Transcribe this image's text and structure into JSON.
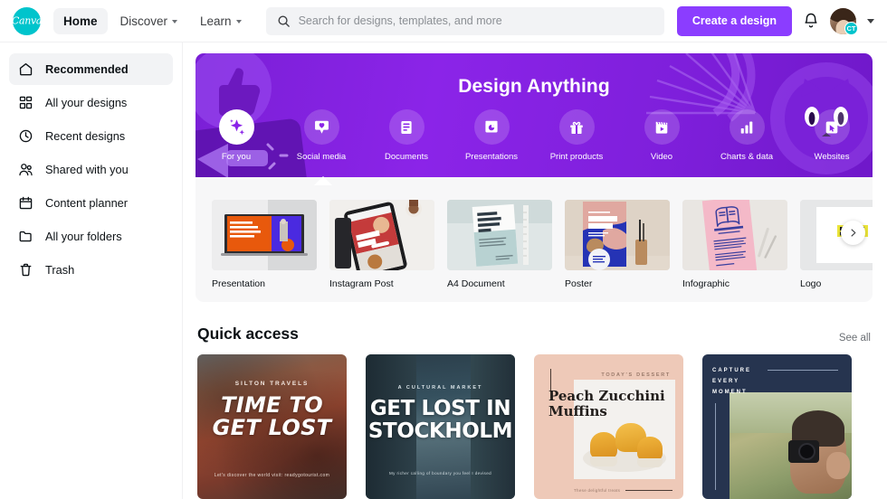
{
  "brand": {
    "name": "Canva",
    "logo_color": "#00c4cc",
    "accent_color": "#8b3dff"
  },
  "header": {
    "nav": [
      {
        "label": "Home",
        "active": true,
        "has_caret": false
      },
      {
        "label": "Discover",
        "active": false,
        "has_caret": true
      },
      {
        "label": "Learn",
        "active": false,
        "has_caret": true
      }
    ],
    "search": {
      "placeholder": "Search for designs, templates, and more",
      "value": "",
      "icon": "search-icon"
    },
    "create_button": "Create a design",
    "notifications_icon": "bell-icon",
    "avatar_badge": "CT",
    "account_caret_icon": "chevron-down-icon"
  },
  "sidebar": {
    "items": [
      {
        "label": "Recommended",
        "icon": "home-icon",
        "active": true
      },
      {
        "label": "All your designs",
        "icon": "grid-icon",
        "active": false
      },
      {
        "label": "Recent designs",
        "icon": "clock-icon",
        "active": false
      },
      {
        "label": "Shared with you",
        "icon": "people-icon",
        "active": false
      },
      {
        "label": "Content planner",
        "icon": "calendar-icon",
        "active": false
      },
      {
        "label": "All your folders",
        "icon": "folder-icon",
        "active": false
      },
      {
        "label": "Trash",
        "icon": "trash-icon",
        "active": false
      }
    ]
  },
  "banner": {
    "title": "Design Anything",
    "background_color": "#8b24e8",
    "categories": [
      {
        "label": "For you",
        "icon": "sparkle-icon",
        "featured": true
      },
      {
        "label": "Social media",
        "icon": "heart-chat-icon",
        "featured": false
      },
      {
        "label": "Documents",
        "icon": "document-icon",
        "featured": false
      },
      {
        "label": "Presentations",
        "icon": "presentation-icon",
        "featured": false
      },
      {
        "label": "Print products",
        "icon": "gift-icon",
        "featured": false
      },
      {
        "label": "Video",
        "icon": "clapperboard-icon",
        "featured": false
      },
      {
        "label": "Charts & data",
        "icon": "bar-chart-icon",
        "featured": false
      },
      {
        "label": "Websites",
        "icon": "website-icon",
        "featured": false
      }
    ],
    "decorations": [
      "thumbs-up-icon",
      "megaphone-icon",
      "cat-face-icon",
      "sunburst-icon"
    ]
  },
  "templates": {
    "next_arrow_icon": "chevron-right-icon",
    "items": [
      {
        "label": "Presentation",
        "preview_text": "WHY CHOOSE THE ACTIVE LIFESTYLE"
      },
      {
        "label": "Instagram Post",
        "preview_text": "MID YEAR SALE"
      },
      {
        "label": "A4 Document",
        "preview_text": "MID-QUARTER REPORT 2021"
      },
      {
        "label": "Poster",
        "preview_text": "Pride Art Showcase"
      },
      {
        "label": "Infographic",
        "preview_text": "CHAPTER ONE"
      },
      {
        "label": "Logo",
        "preview_text": "defile de mode"
      }
    ]
  },
  "quick_access": {
    "title": "Quick access",
    "see_all": "See all",
    "cards": [
      {
        "eyebrow": "SILTON TRAVELS",
        "title": "TIME TO GET LOST",
        "footer": "Let's discover the world\nvisit: readygotourist.com"
      },
      {
        "eyebrow": "A CULTURAL MARKET",
        "title": "GET LOST IN STOCKHOLM",
        "footer": "My richer calling of boundary you feel I devised"
      },
      {
        "eyebrow": "TODAY'S DESSERT",
        "title": "Peach Zucchini Muffins",
        "footer": "These delightful treats"
      },
      {
        "eyebrow": "CAPTURE EVERY MOMENT",
        "title": "",
        "footer": ""
      }
    ]
  }
}
